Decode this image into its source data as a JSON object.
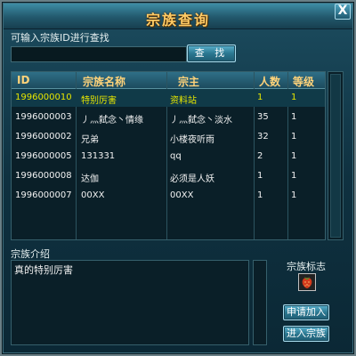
{
  "window": {
    "title": "宗族查询",
    "close_label": "X"
  },
  "search": {
    "label": "可输入宗族ID进行查找",
    "value": "",
    "placeholder": "",
    "button": "查 找"
  },
  "table": {
    "headers": [
      "ID",
      "宗族名称",
      "宗主",
      "人数",
      "等级"
    ],
    "rows": [
      [
        "1996000010",
        "特别厉害",
        "资料站",
        "1",
        "1"
      ],
      [
        "1996000003",
        "丿灬弑念丶情缘",
        "丿灬弑念丶淡水",
        "35",
        "1"
      ],
      [
        "1996000002",
        "兄弟",
        "小楼夜听雨",
        "32",
        "1"
      ],
      [
        "1996000005",
        "131331",
        "qq",
        "2",
        "1"
      ],
      [
        "1996000008",
        "达伽",
        "必须是人妖",
        "1",
        "1"
      ],
      [
        "1996000007",
        "00XX",
        "00XX",
        "1",
        "1"
      ]
    ],
    "selected_index": 0
  },
  "intro": {
    "label": "宗族介绍",
    "text": "真的特别厉害"
  },
  "emblem": {
    "label": "宗族标志",
    "icon": "strawberry-emblem-icon"
  },
  "actions": {
    "apply": "申请加入",
    "enter": "进入宗族"
  },
  "colors": {
    "title": "#ffcc66",
    "header_text": "#ffd37a",
    "selected_row_text": "#e6e600",
    "cell_text": "#f2f2f2"
  }
}
